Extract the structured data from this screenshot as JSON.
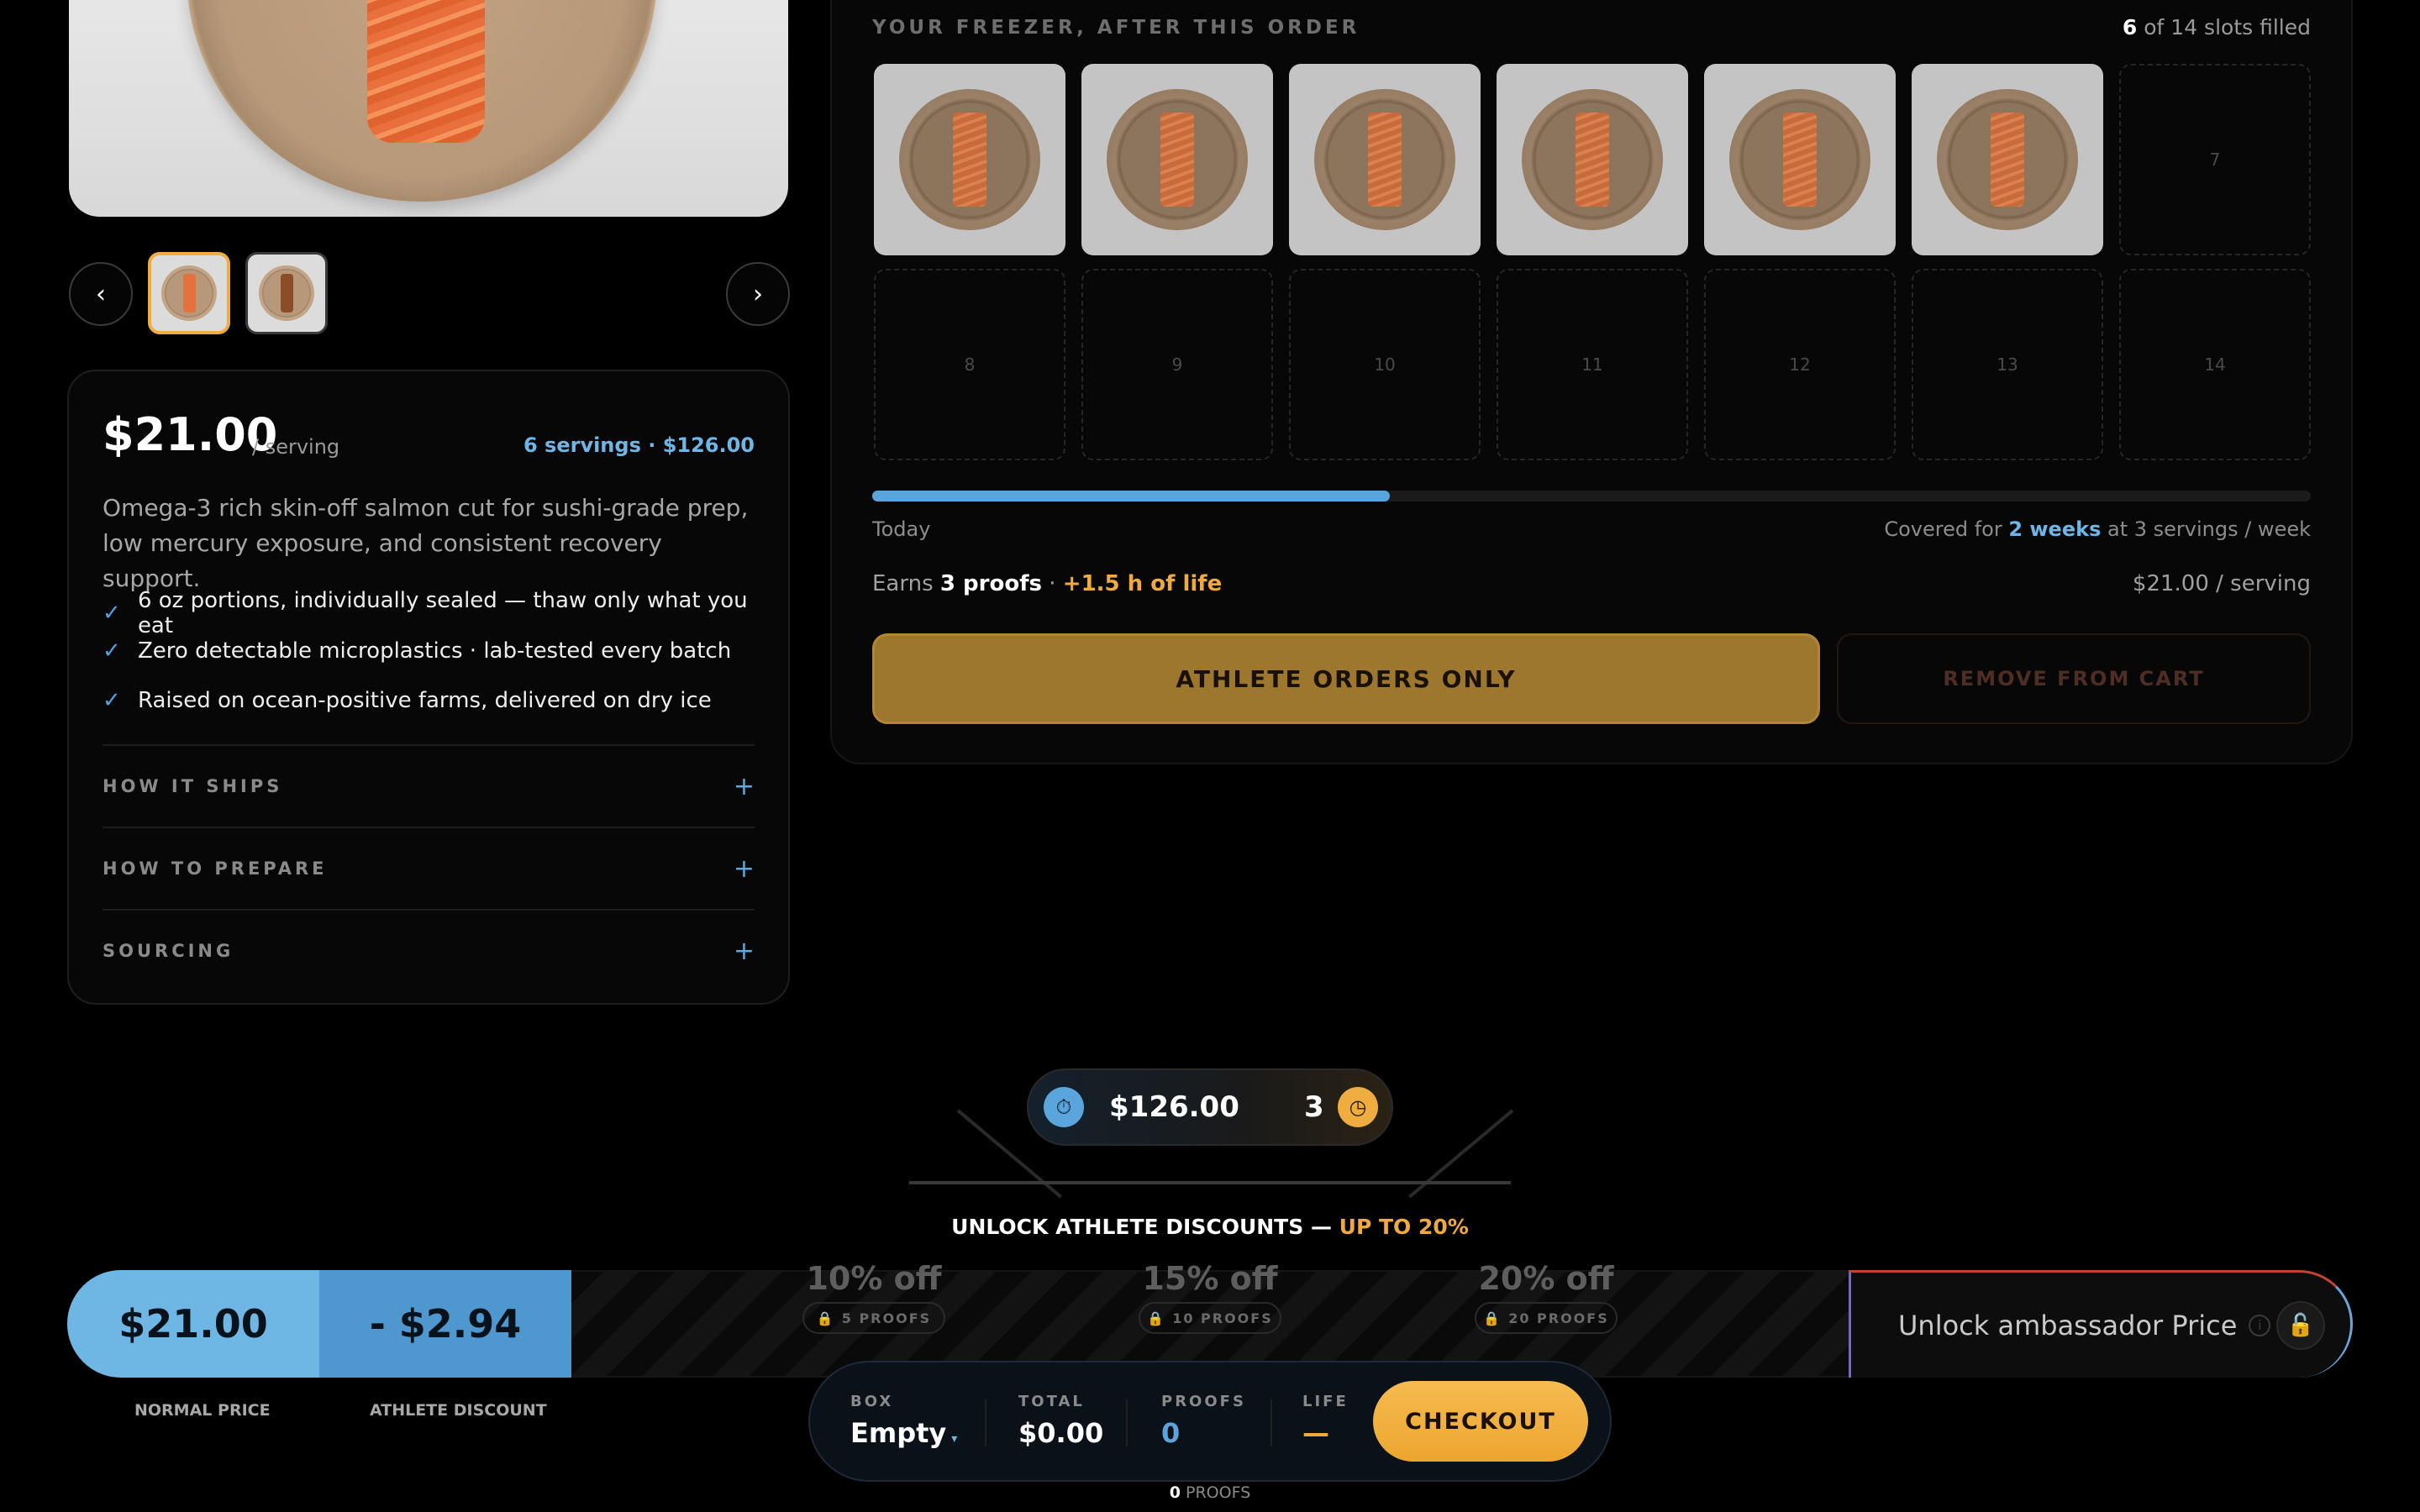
{
  "gallery": {
    "prev_icon": "‹",
    "next_icon": "›"
  },
  "product": {
    "price": "$21.00",
    "per": "/ serving",
    "summary": "6 servings · $126.00",
    "description": "Omega-3 rich skin-off salmon cut for sushi-grade prep, low mercury exposure, and consistent recovery support.",
    "features": [
      "6 oz portions, individually sealed — thaw only what you eat",
      "Zero detectable microplastics · lab-tested every batch",
      "Raised on ocean-positive farms, delivered on dry ice"
    ],
    "accordions": [
      "HOW IT SHIPS",
      "HOW TO PREPARE",
      "SOURCING"
    ],
    "check_icon": "✓",
    "plus_icon": "+"
  },
  "freezer": {
    "title": "YOUR FREEZER, AFTER THIS ORDER",
    "filled": "6",
    "count_suffix": " of 14 slots filled",
    "empty_slots": [
      "7",
      "8",
      "9",
      "10",
      "11",
      "12",
      "13",
      "14"
    ],
    "progress": 0.36,
    "today": "Today",
    "covered_prefix": "Covered for ",
    "covered_value": "2 weeks",
    "covered_suffix": " at 3 servings / week",
    "earns_prefix": "Earns ",
    "earns_proofs": "3 proofs",
    "earns_sep": " · ",
    "earns_life": "+1.5 h of life",
    "serving_price": "$21.00 / serving",
    "athlete_button": "ATHLETE ORDERS ONLY",
    "remove_button": "REMOVE FROM CART"
  },
  "hud": {
    "amount": "$126.00",
    "count": "3",
    "unlock_title": "UNLOCK ATHLETE DISCOUNTS — ",
    "unlock_highlight": "UP TO 20%",
    "normal_price": "$21.00",
    "discount": "- $2.94",
    "normal_label": "NORMAL PRICE",
    "discount_label": "ATHLETE DISCOUNT",
    "tiers": [
      {
        "pct": "10% off",
        "proofs": "5 PROOFS"
      },
      {
        "pct": "15% off",
        "proofs": "10 PROOFS"
      },
      {
        "pct": "20% off",
        "proofs": "20 PROOFS"
      }
    ],
    "ambassador": "Unlock ambassador Price"
  },
  "cart": {
    "box_label": "BOX",
    "box_value": "Empty",
    "total_label": "TOTAL",
    "total_value": "$0.00",
    "proofs_label": "PROOFS",
    "proofs_value": "0",
    "life_label": "LIFE",
    "life_value": "—",
    "checkout": "CHECKOUT",
    "footer_count": "0",
    "footer_label": " PROOFS"
  }
}
